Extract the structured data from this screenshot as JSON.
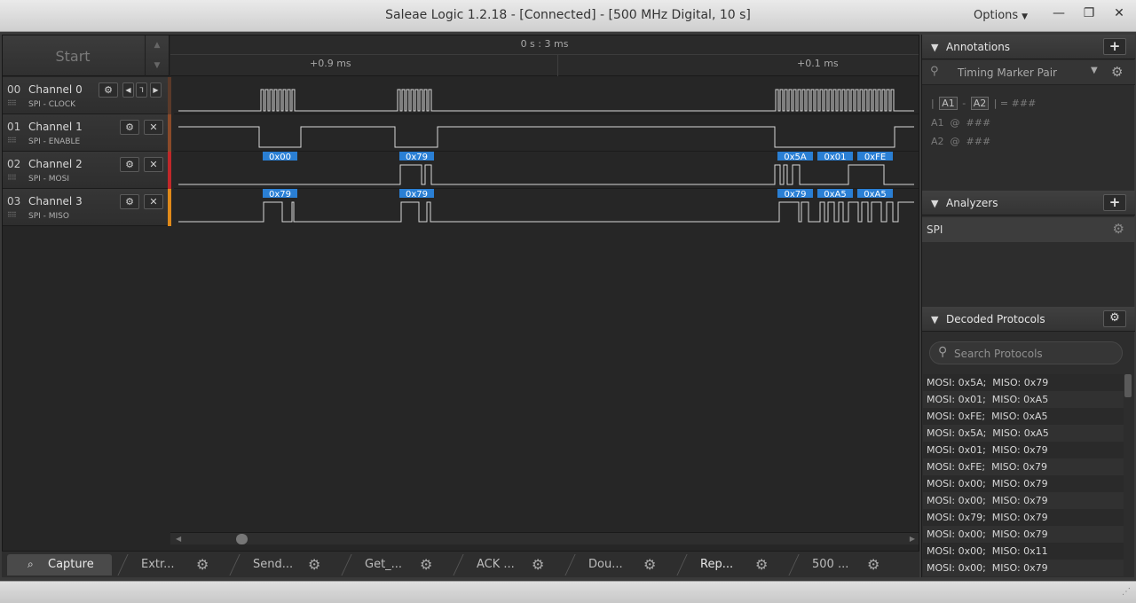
{
  "window": {
    "title": "Saleae Logic 1.2.18 - [Connected] - [500 MHz Digital, 10 s]",
    "options_label": "Options",
    "minimize_glyph": "—",
    "restore_glyph": "❐",
    "close_glyph": "✕"
  },
  "capture": {
    "start_label": "Start"
  },
  "ruler": {
    "center_label": "0 s : 3 ms",
    "tick_left": "+0.9 ms",
    "tick_right": "+0.1 ms"
  },
  "channels": [
    {
      "num": "00",
      "name": "Channel 0",
      "sub": "SPI - CLOCK",
      "color": "#8a4a2a"
    },
    {
      "num": "01",
      "name": "Channel 1",
      "sub": "SPI - ENABLE",
      "color": "#8a4a2a"
    },
    {
      "num": "02",
      "name": "Channel 2",
      "sub": "SPI - MOSI",
      "color": "#c0282a"
    },
    {
      "num": "03",
      "name": "Channel 3",
      "sub": "SPI - MISO",
      "color": "#e08a1a"
    }
  ],
  "decode_labels": {
    "mosi": [
      "0x00",
      "0x79",
      "0x5A",
      "0x01",
      "0xFE"
    ],
    "miso": [
      "0x79",
      "0x79",
      "0x79",
      "0xA5",
      "0xA5"
    ]
  },
  "tabs": [
    {
      "label": "Capture"
    },
    {
      "label": "Extr..."
    },
    {
      "label": "Send..."
    },
    {
      "label": "Get_..."
    },
    {
      "label": "ACK ..."
    },
    {
      "label": "Dou..."
    },
    {
      "label": "Rep..."
    },
    {
      "label": "500 ..."
    }
  ],
  "annotations": {
    "title": "Annotations",
    "add_glyph": "+",
    "pair_name": "Timing Marker Pair",
    "a1": "A1",
    "a2": "A2",
    "diff_value": "###",
    "a1_value": "###",
    "a2_value": "###"
  },
  "analyzers": {
    "title": "Analyzers",
    "add_glyph": "+",
    "items": [
      {
        "label": "SPI"
      }
    ]
  },
  "decoded": {
    "title": "Decoded Protocols",
    "search_placeholder": "Search Protocols",
    "rows": [
      "MOSI: 0x5A;  MISO: 0x79",
      "MOSI: 0x01;  MISO: 0xA5",
      "MOSI: 0xFE;  MISO: 0xA5",
      "MOSI: 0x5A;  MISO: 0xA5",
      "MOSI: 0x01;  MISO: 0x79",
      "MOSI: 0xFE;  MISO: 0x79",
      "MOSI: 0x00;  MISO: 0x79",
      "MOSI: 0x00;  MISO: 0x79",
      "MOSI: 0x79;  MISO: 0x79",
      "MOSI: 0x00;  MISO: 0x79",
      "MOSI: 0x00;  MISO: 0x11",
      "MOSI: 0x00;  MISO: 0x79"
    ]
  },
  "colors": {
    "decode_badge": "#2a7fd4",
    "trace": "#d8d8d8",
    "accent": "#e08a1a"
  }
}
